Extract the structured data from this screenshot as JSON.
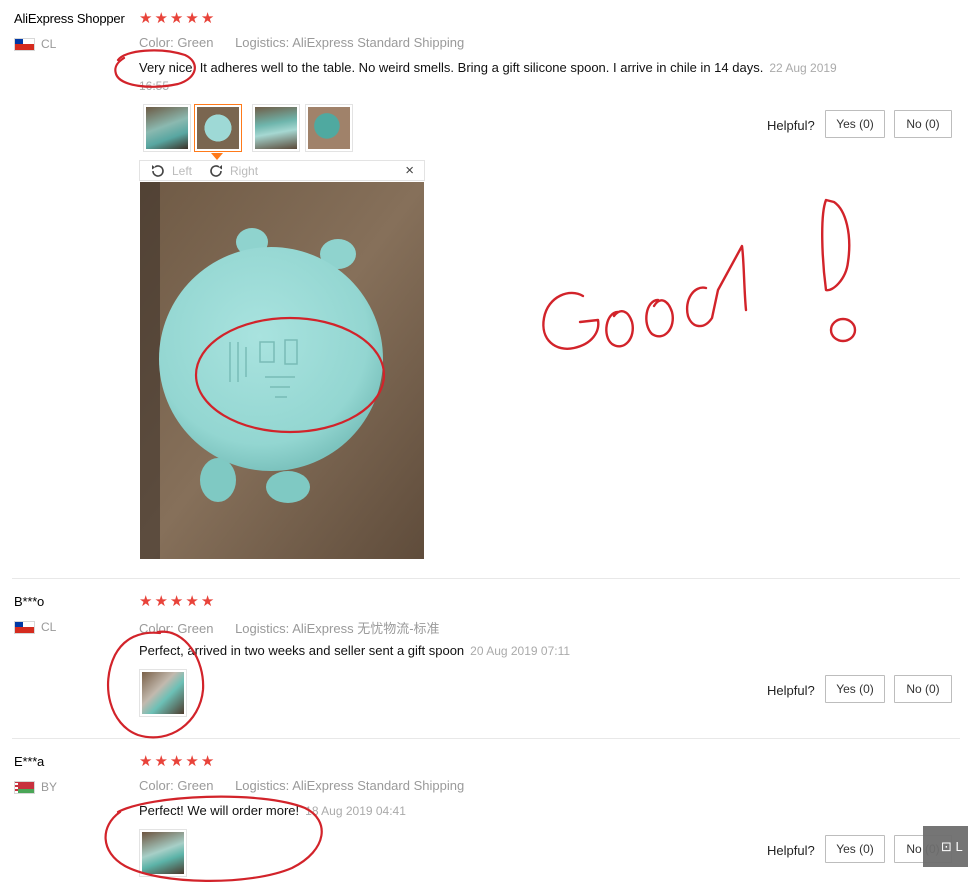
{
  "reviews": [
    {
      "user": "AliExpress Shopper",
      "country": "CL",
      "color_label": "Color:",
      "color_value": "Green",
      "logistics_label": "Logistics:",
      "logistics_value": "AliExpress Standard Shipping",
      "text": "Very nice. It adheres well to the table. No weird smells. Bring a gift silicone spoon. I arrive in chile in 14 days.",
      "date_line1": "22 Aug 2019",
      "date_line2": "16:55",
      "stars": 5
    },
    {
      "user": "B***o",
      "country": "CL",
      "color_label": "Color:",
      "color_value": "Green",
      "logistics_label": "Logistics:",
      "logistics_value": "AliExpress 无忧物流-标准",
      "text": "Perfect, arrived in two weeks and seller sent a gift spoon",
      "date": "20 Aug 2019 07:11",
      "stars": 5
    },
    {
      "user": "E***a",
      "country": "BY",
      "color_label": "Color:",
      "color_value": "Green",
      "logistics_label": "Logistics:",
      "logistics_value": "AliExpress Standard Shipping",
      "text": "Perfect! We will order more!",
      "date": "18 Aug 2019 04:41",
      "stars": 5
    }
  ],
  "helpful": {
    "label": "Helpful?",
    "yes_label": "Yes (0)",
    "no_label": "No (0)"
  },
  "viewer": {
    "rotate_left": "Left",
    "rotate_right": "Right",
    "close": "×"
  },
  "annotation": {
    "handwritten": "Good !"
  },
  "colors": {
    "star": "#e8433a",
    "accent": "#ff7a1a",
    "annotation_red": "#d2232a",
    "gray_text": "#9a9a9a"
  },
  "icons": {
    "rotate_left": "rotate-left-icon",
    "rotate_right": "rotate-right-icon",
    "close": "close-icon",
    "star": "star-icon",
    "flag": "flag-icon"
  },
  "widget_label": "⊡ L"
}
